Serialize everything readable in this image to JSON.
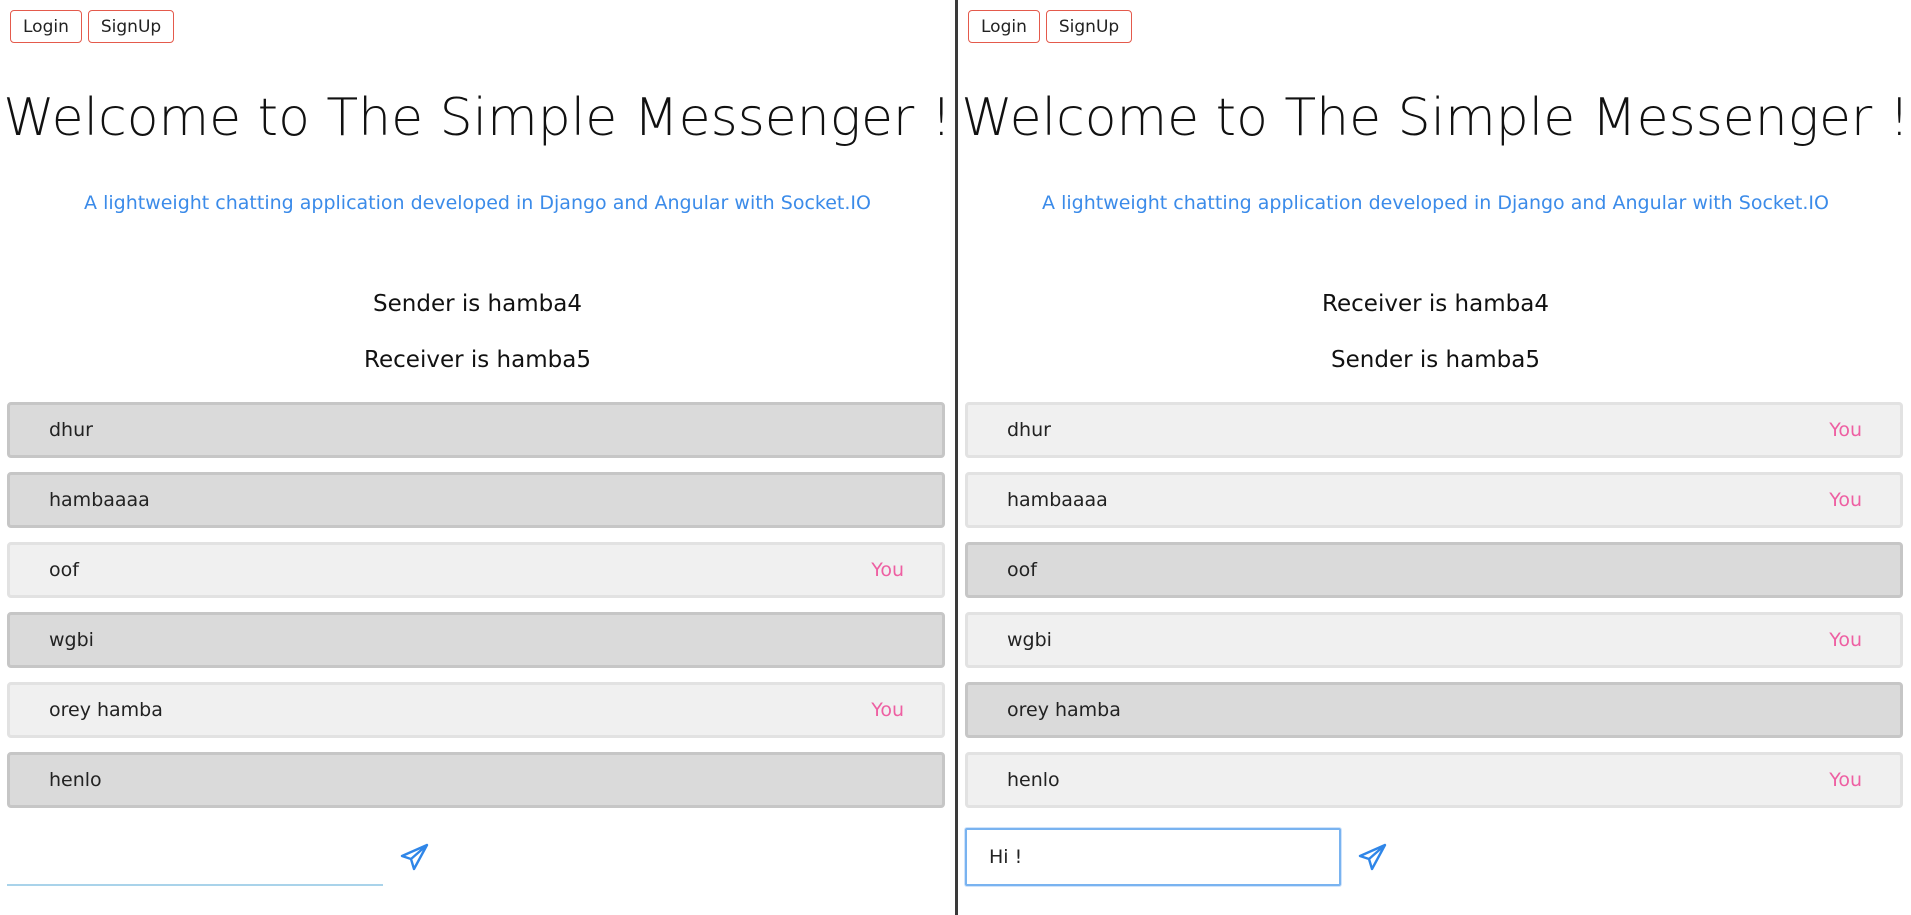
{
  "colors": {
    "nav_border": "#e45a4c",
    "subtitle": "#3b8be9",
    "you_label": "#ee5fa2",
    "send_icon": "#2f86e8",
    "other_msg_bg": "#dadada",
    "mine_msg_bg": "#f0f0f0"
  },
  "panes": [
    {
      "nav": {
        "login_label": "Login",
        "signup_label": "SignUp"
      },
      "title": "Welcome to The Simple Messenger !",
      "subtitle": "A lightweight chatting application developed in Django and Angular with Socket.IO",
      "info_line_1": "Sender is hamba4",
      "info_line_2": "Receiver is hamba5",
      "messages": [
        {
          "text": "dhur",
          "you": "",
          "mine": false
        },
        {
          "text": "hambaaaa",
          "you": "",
          "mine": false
        },
        {
          "text": "oof",
          "you": "You",
          "mine": true
        },
        {
          "text": "wgbi",
          "you": "",
          "mine": false
        },
        {
          "text": "orey hamba",
          "you": "You",
          "mine": true
        },
        {
          "text": "henlo",
          "you": "",
          "mine": false
        }
      ],
      "composer": {
        "value": "",
        "focused": false,
        "send_icon": "paper-plane-icon"
      }
    },
    {
      "nav": {
        "login_label": "Login",
        "signup_label": "SignUp"
      },
      "title": "Welcome to The Simple Messenger !",
      "subtitle": "A lightweight chatting application developed in Django and Angular with Socket.IO",
      "info_line_1": "Receiver is hamba4",
      "info_line_2": "Sender is hamba5",
      "messages": [
        {
          "text": "dhur",
          "you": "You",
          "mine": true
        },
        {
          "text": "hambaaaa",
          "you": "You",
          "mine": true
        },
        {
          "text": "oof",
          "you": "",
          "mine": false
        },
        {
          "text": "wgbi",
          "you": "You",
          "mine": true
        },
        {
          "text": "orey hamba",
          "you": "",
          "mine": false
        },
        {
          "text": "henlo",
          "you": "You",
          "mine": true
        }
      ],
      "composer": {
        "value": "Hi !",
        "focused": true,
        "send_icon": "paper-plane-icon"
      }
    }
  ]
}
